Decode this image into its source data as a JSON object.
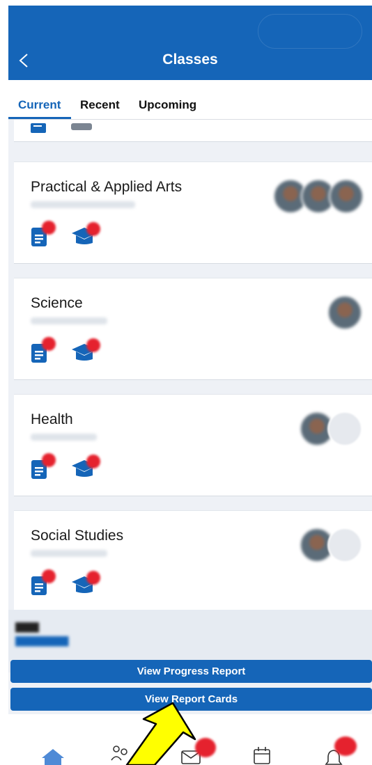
{
  "header": {
    "title": "Classes",
    "back_icon": "chevron-left-icon",
    "color": "#1565b8"
  },
  "tabs": [
    {
      "label": "Current",
      "active": true
    },
    {
      "label": "Recent",
      "active": false
    },
    {
      "label": "Upcoming",
      "active": false
    }
  ],
  "classes": [
    {
      "name": "Practical & Applied Arts",
      "icons": [
        "assignment-icon",
        "grades-cap-icon"
      ],
      "avatar_count": 3
    },
    {
      "name": "Science",
      "icons": [
        "assignment-icon",
        "grades-cap-icon"
      ],
      "avatar_count": 1
    },
    {
      "name": "Health",
      "icons": [
        "assignment-icon",
        "grades-cap-icon"
      ],
      "avatar_count": 2
    },
    {
      "name": "Social Studies",
      "icons": [
        "assignment-icon",
        "grades-cap-icon"
      ],
      "avatar_count": 2
    }
  ],
  "buttons": {
    "progress_report": "View Progress Report",
    "report_cards": "View Report Cards"
  },
  "bottom_nav": [
    "home-icon",
    "people-icon",
    "mail-icon",
    "calendar-icon",
    "bell-icon"
  ],
  "colors": {
    "brand": "#1565b8",
    "badge": "#e5222e",
    "annotation_arrow": "#ffff00"
  }
}
